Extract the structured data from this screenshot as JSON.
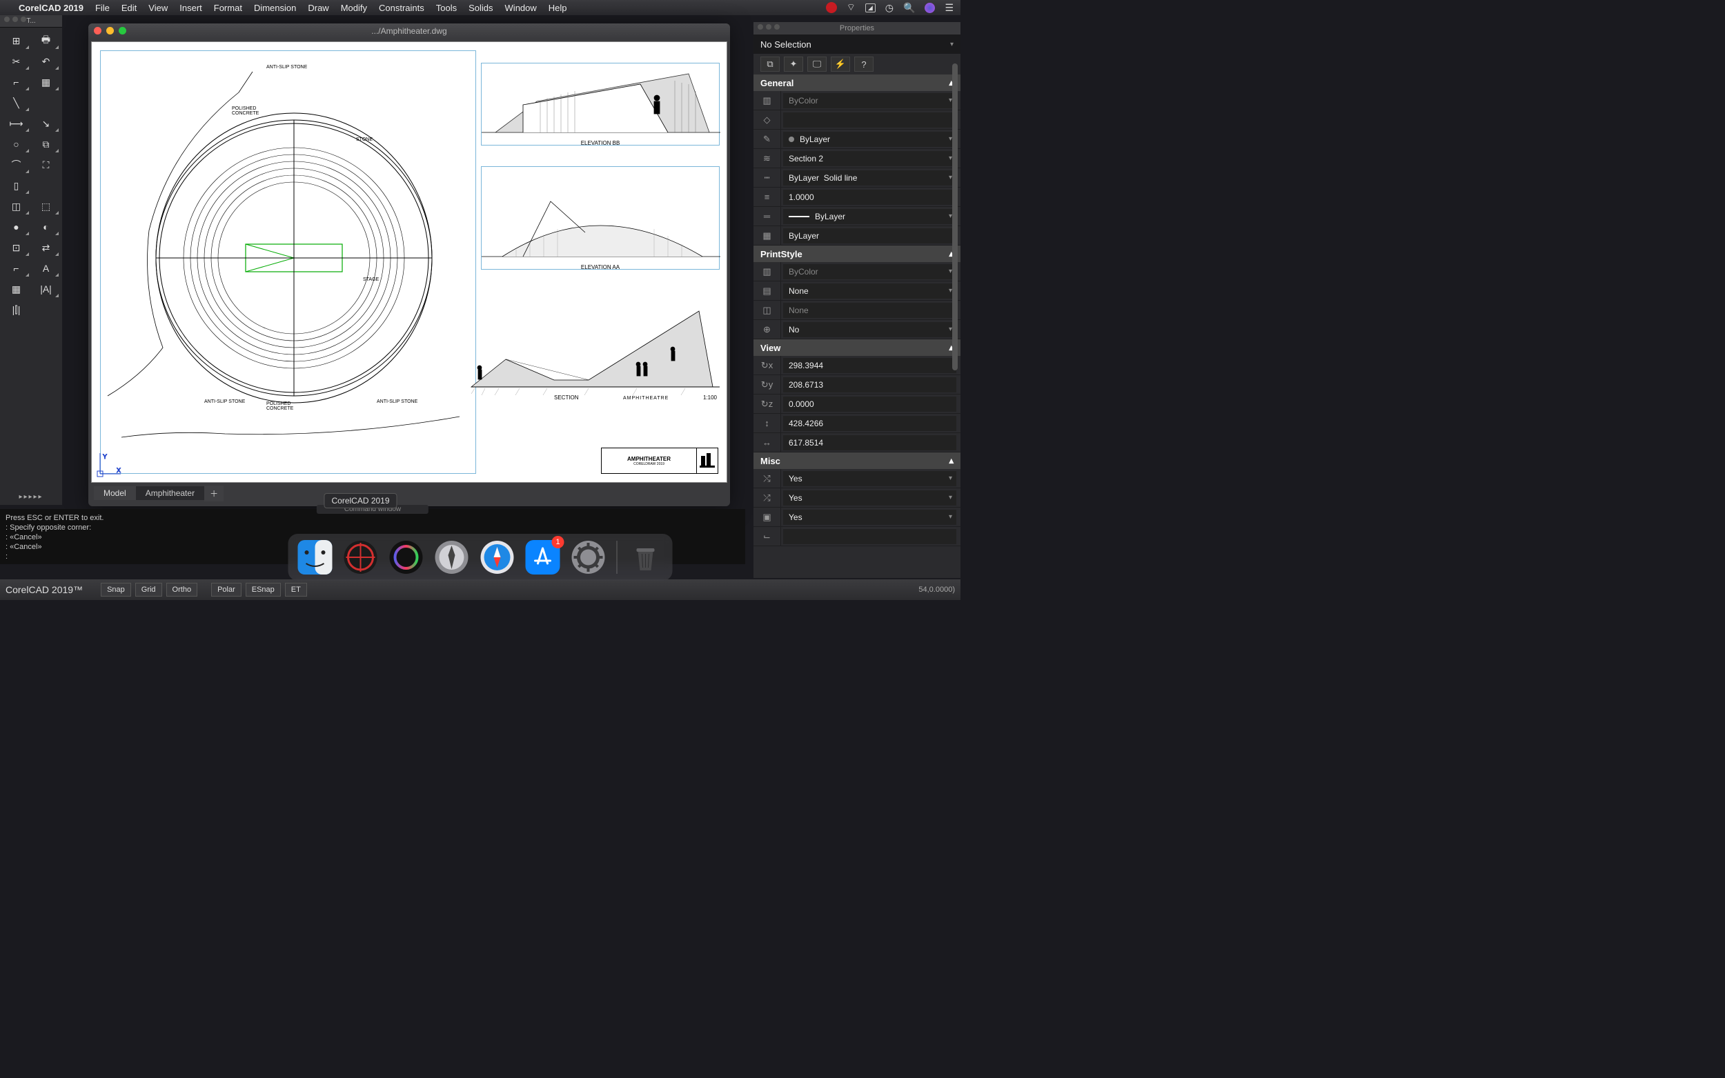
{
  "menubar": {
    "app": "CorelCAD 2019",
    "items": [
      "File",
      "Edit",
      "View",
      "Insert",
      "Format",
      "Dimension",
      "Draw",
      "Modify",
      "Constraints",
      "Tools",
      "Solids",
      "Window",
      "Help"
    ]
  },
  "left_toolbar": {
    "title": "T..."
  },
  "document": {
    "title": ".../Amphitheater.dwg",
    "tabs": {
      "model": "Model",
      "layout": "Amphitheater"
    },
    "labels": {
      "elev_bb": "ELEVATION BB",
      "elev_aa": "ELEVATION AA",
      "section": "SECTION",
      "amphitheater_lbl": "AMPHITHEATRE",
      "scale": "1:100",
      "titleblock": "AMPHITHEATER",
      "titleblock_sub": "CORELDRAW 2019",
      "anti_slip": "ANTI-SLIP STONE",
      "polished": "POLISHED\nCONCRETE",
      "stone": "STONE",
      "stage": "STAGE"
    }
  },
  "command": {
    "title": "Command window",
    "lines": [
      "Press ESC or ENTER to exit.",
      ": Specify opposite corner:",
      "",
      ": «Cancel»",
      ": «Cancel»",
      ":"
    ]
  },
  "statusbar": {
    "brand": "CorelCAD 2019™",
    "toggles": [
      "Snap",
      "Grid",
      "Ortho",
      "Polar",
      "ESnap",
      "ET"
    ],
    "coords": "54,0.0000)"
  },
  "properties": {
    "title": "Properties",
    "selection": "No Selection",
    "sections": {
      "general": {
        "title": "General",
        "rows": [
          {
            "icon": "palette",
            "value": "ByColor",
            "dd": true,
            "dim": true
          },
          {
            "icon": "eraser",
            "value": "",
            "dd": false
          },
          {
            "icon": "pencil",
            "value": "ByLayer",
            "dd": true,
            "dot": true
          },
          {
            "icon": "layers",
            "value": "Section 2",
            "dd": true
          },
          {
            "icon": "linetype",
            "value": "ByLayer",
            "value2": "Solid line",
            "dd": true
          },
          {
            "icon": "weight",
            "value": "1.0000",
            "dd": false
          },
          {
            "icon": "lineweight",
            "value": "ByLayer",
            "dd": true,
            "line": true
          },
          {
            "icon": "hatch",
            "value": "ByLayer",
            "dd": false
          }
        ]
      },
      "printstyle": {
        "title": "PrintStyle",
        "rows": [
          {
            "icon": "palette",
            "value": "ByColor",
            "dd": true,
            "dim": true
          },
          {
            "icon": "table",
            "value": "None",
            "dd": true
          },
          {
            "icon": "chart",
            "value": "None",
            "dd": false,
            "dim": true
          },
          {
            "icon": "target",
            "value": "No",
            "dd": true
          }
        ]
      },
      "view": {
        "title": "View",
        "rows": [
          {
            "icon": "cx",
            "value": "298.3944"
          },
          {
            "icon": "cy",
            "value": "208.6713"
          },
          {
            "icon": "cz",
            "value": "0.0000"
          },
          {
            "icon": "ht",
            "value": "428.4266"
          },
          {
            "icon": "wd",
            "value": "617.8514"
          }
        ]
      },
      "misc": {
        "title": "Misc",
        "rows": [
          {
            "icon": "axis",
            "value": "Yes",
            "dd": true
          },
          {
            "icon": "axis2",
            "value": "Yes",
            "dd": true
          },
          {
            "icon": "box",
            "value": "Yes",
            "dd": true
          },
          {
            "icon": "ucs",
            "value": ""
          }
        ]
      }
    }
  },
  "dock": {
    "tooltip": "CorelCAD 2019",
    "badge": "1"
  }
}
